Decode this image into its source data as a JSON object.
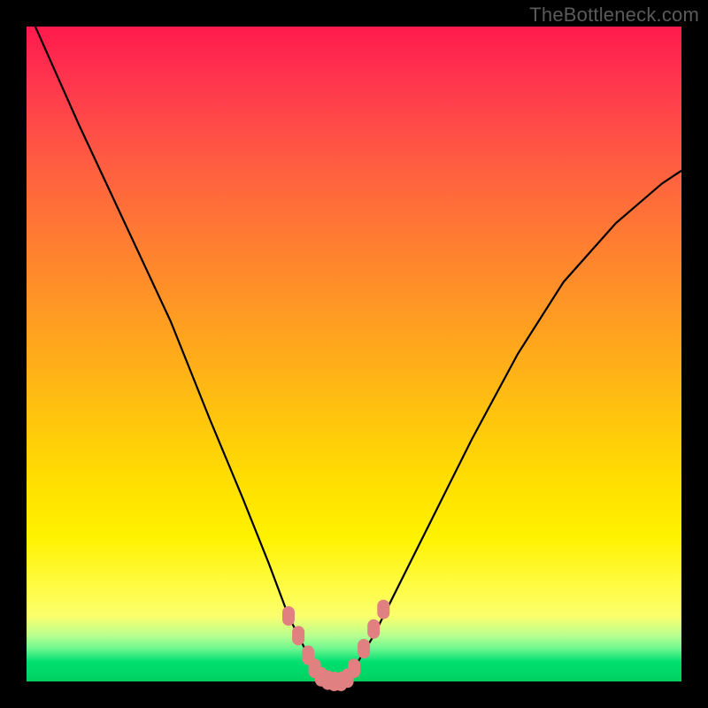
{
  "watermark": "TheBottleneck.com",
  "chart_data": {
    "type": "line",
    "title": "",
    "xlabel": "",
    "ylabel": "",
    "xlim": [
      0,
      100
    ],
    "ylim": [
      0,
      100
    ],
    "grid": false,
    "series": [
      {
        "name": "left-curve",
        "x": [
          0,
          8,
          15,
          22,
          28,
          33,
          37,
          40,
          43,
          45,
          47
        ],
        "values": [
          103,
          85,
          70,
          55,
          40,
          28,
          18,
          10,
          4,
          1,
          0
        ]
      },
      {
        "name": "right-curve",
        "x": [
          47,
          50,
          53,
          57,
          62,
          68,
          75,
          82,
          90,
          97,
          100
        ],
        "values": [
          0,
          2,
          7,
          15,
          25,
          37,
          50,
          61,
          70,
          76,
          78
        ]
      }
    ],
    "markers": {
      "name": "salmon-dots",
      "color": "#e08080",
      "points": [
        {
          "x": 40,
          "y": 10
        },
        {
          "x": 41.5,
          "y": 7
        },
        {
          "x": 43,
          "y": 4
        },
        {
          "x": 44,
          "y": 2
        },
        {
          "x": 45,
          "y": 0.7
        },
        {
          "x": 46,
          "y": 0.2
        },
        {
          "x": 47,
          "y": 0
        },
        {
          "x": 48,
          "y": 0
        },
        {
          "x": 49,
          "y": 0.5
        },
        {
          "x": 50,
          "y": 2
        },
        {
          "x": 51.5,
          "y": 5
        },
        {
          "x": 53,
          "y": 8
        },
        {
          "x": 54.5,
          "y": 11
        }
      ]
    },
    "gradient_stops": [
      {
        "pos": 0.0,
        "color": "#ff1a4d"
      },
      {
        "pos": 0.5,
        "color": "#ffb000"
      },
      {
        "pos": 0.8,
        "color": "#fff200"
      },
      {
        "pos": 0.95,
        "color": "#40e880"
      },
      {
        "pos": 1.0,
        "color": "#00d060"
      }
    ]
  }
}
